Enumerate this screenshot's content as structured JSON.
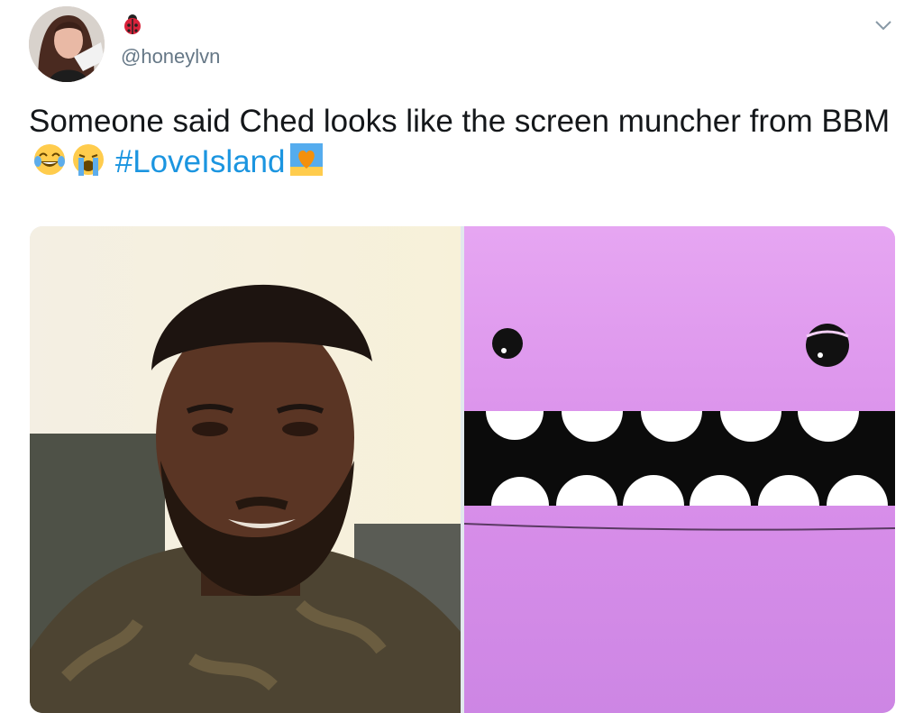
{
  "user": {
    "display_name_icon": "ladybug-icon",
    "handle": "@honeylvn",
    "avatar": "avatar"
  },
  "menu": {
    "caret_icon": "chevron-down-icon"
  },
  "tweet": {
    "text_main": "Someone said Ched looks like the screen muncher from BBM",
    "emojis": [
      "laughing-tears-emoji",
      "crying-emoji"
    ],
    "hashtag": "#LoveIsland",
    "hashtag_emoji": "island-heart-emoji"
  },
  "media": {
    "left_image": "photo-of-man",
    "right_image": "purple-screen-muncher-character"
  },
  "colors": {
    "link": "#1b95e0",
    "text": "#14171a",
    "secondary": "#657786",
    "muncher_purple": "#d892e9"
  }
}
